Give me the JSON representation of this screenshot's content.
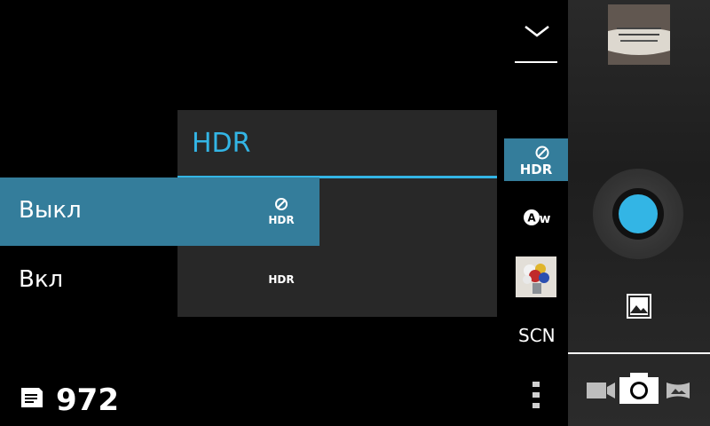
{
  "popup": {
    "title": "HDR",
    "options": [
      {
        "label": "Выкл",
        "icon": "hdr-off-icon",
        "selected": true
      },
      {
        "label": "Вкл",
        "icon": "hdr-icon",
        "selected": false
      }
    ]
  },
  "strip": {
    "hdr_text": "HDR",
    "scene_label": "SCN"
  },
  "storage": {
    "remaining": "972"
  },
  "colors": {
    "accent": "#33b5e5",
    "selected_bg": "#347d9b",
    "popup_bg": "#282828"
  }
}
